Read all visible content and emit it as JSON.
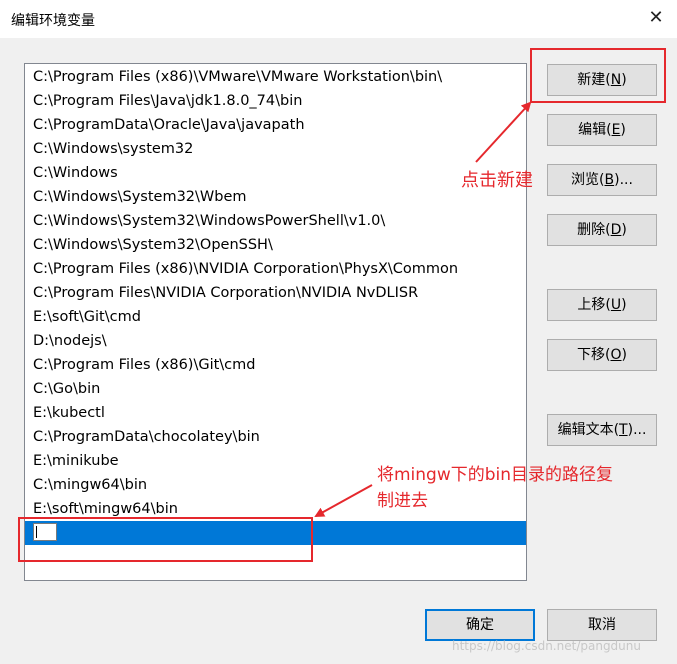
{
  "window": {
    "title": "编辑环境变量",
    "close_glyph": "✕"
  },
  "path_list": {
    "items": [
      "C:\\Program Files (x86)\\VMware\\VMware Workstation\\bin\\",
      "C:\\Program Files\\Java\\jdk1.8.0_74\\bin",
      "C:\\ProgramData\\Oracle\\Java\\javapath",
      "C:\\Windows\\system32",
      "C:\\Windows",
      "C:\\Windows\\System32\\Wbem",
      "C:\\Windows\\System32\\WindowsPowerShell\\v1.0\\",
      "C:\\Windows\\System32\\OpenSSH\\",
      "C:\\Program Files (x86)\\NVIDIA Corporation\\PhysX\\Common",
      "C:\\Program Files\\NVIDIA Corporation\\NVIDIA NvDLISR",
      "E:\\soft\\Git\\cmd",
      "D:\\nodejs\\",
      "C:\\Program Files (x86)\\Git\\cmd",
      "C:\\Go\\bin",
      "E:\\kubectl",
      "C:\\ProgramData\\chocolatey\\bin",
      "E:\\minikube",
      "C:\\mingw64\\bin",
      "E:\\soft\\mingw64\\bin"
    ],
    "new_entry_value": ""
  },
  "buttons": {
    "new": {
      "label": "新建(",
      "key": "N",
      "end": ")"
    },
    "edit": {
      "label": "编辑(",
      "key": "E",
      "end": ")"
    },
    "browse": {
      "label": "浏览(",
      "key": "B",
      "end": ")..."
    },
    "delete": {
      "label": "删除(",
      "key": "D",
      "end": ")"
    },
    "move_up": {
      "label": "上移(",
      "key": "U",
      "end": ")"
    },
    "move_down": {
      "label": "下移(",
      "key": "O",
      "end": ")"
    },
    "edit_text": {
      "label": "编辑文本(",
      "key": "T",
      "end": ")..."
    },
    "ok": {
      "label": "确定"
    },
    "cancel": {
      "label": "取消"
    }
  },
  "annotations": {
    "click_new": "点击新建",
    "paste_path_line1": "将mingw下的bin目录的路径复",
    "paste_path_line2": "制进去",
    "color": "#e5282d"
  },
  "watermark": "https://blog.csdn.net/pangdunu"
}
